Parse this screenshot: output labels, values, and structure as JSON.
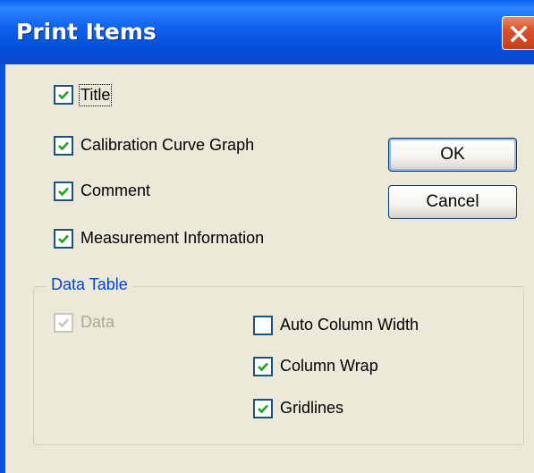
{
  "window": {
    "title": "Print Items",
    "colors": {
      "titlebar": "#0054e3",
      "close": "#d9502c",
      "face": "#ece9d8",
      "group_title": "#0046d5",
      "check": "#21a121"
    }
  },
  "print_items": [
    {
      "label": "Title",
      "checked": true
    },
    {
      "label": "Calibration Curve Graph",
      "checked": true
    },
    {
      "label": "Comment",
      "checked": true
    },
    {
      "label": "Measurement Information",
      "checked": true
    }
  ],
  "buttons": {
    "ok": "OK",
    "cancel": "Cancel"
  },
  "data_table": {
    "title": "Data Table",
    "data": {
      "label": "Data",
      "checked": true,
      "enabled": false
    },
    "auto_column_width": {
      "label": "Auto Column Width",
      "checked": false
    },
    "column_wrap": {
      "label": "Column Wrap",
      "checked": true
    },
    "gridlines": {
      "label": "Gridlines",
      "checked": true
    }
  }
}
